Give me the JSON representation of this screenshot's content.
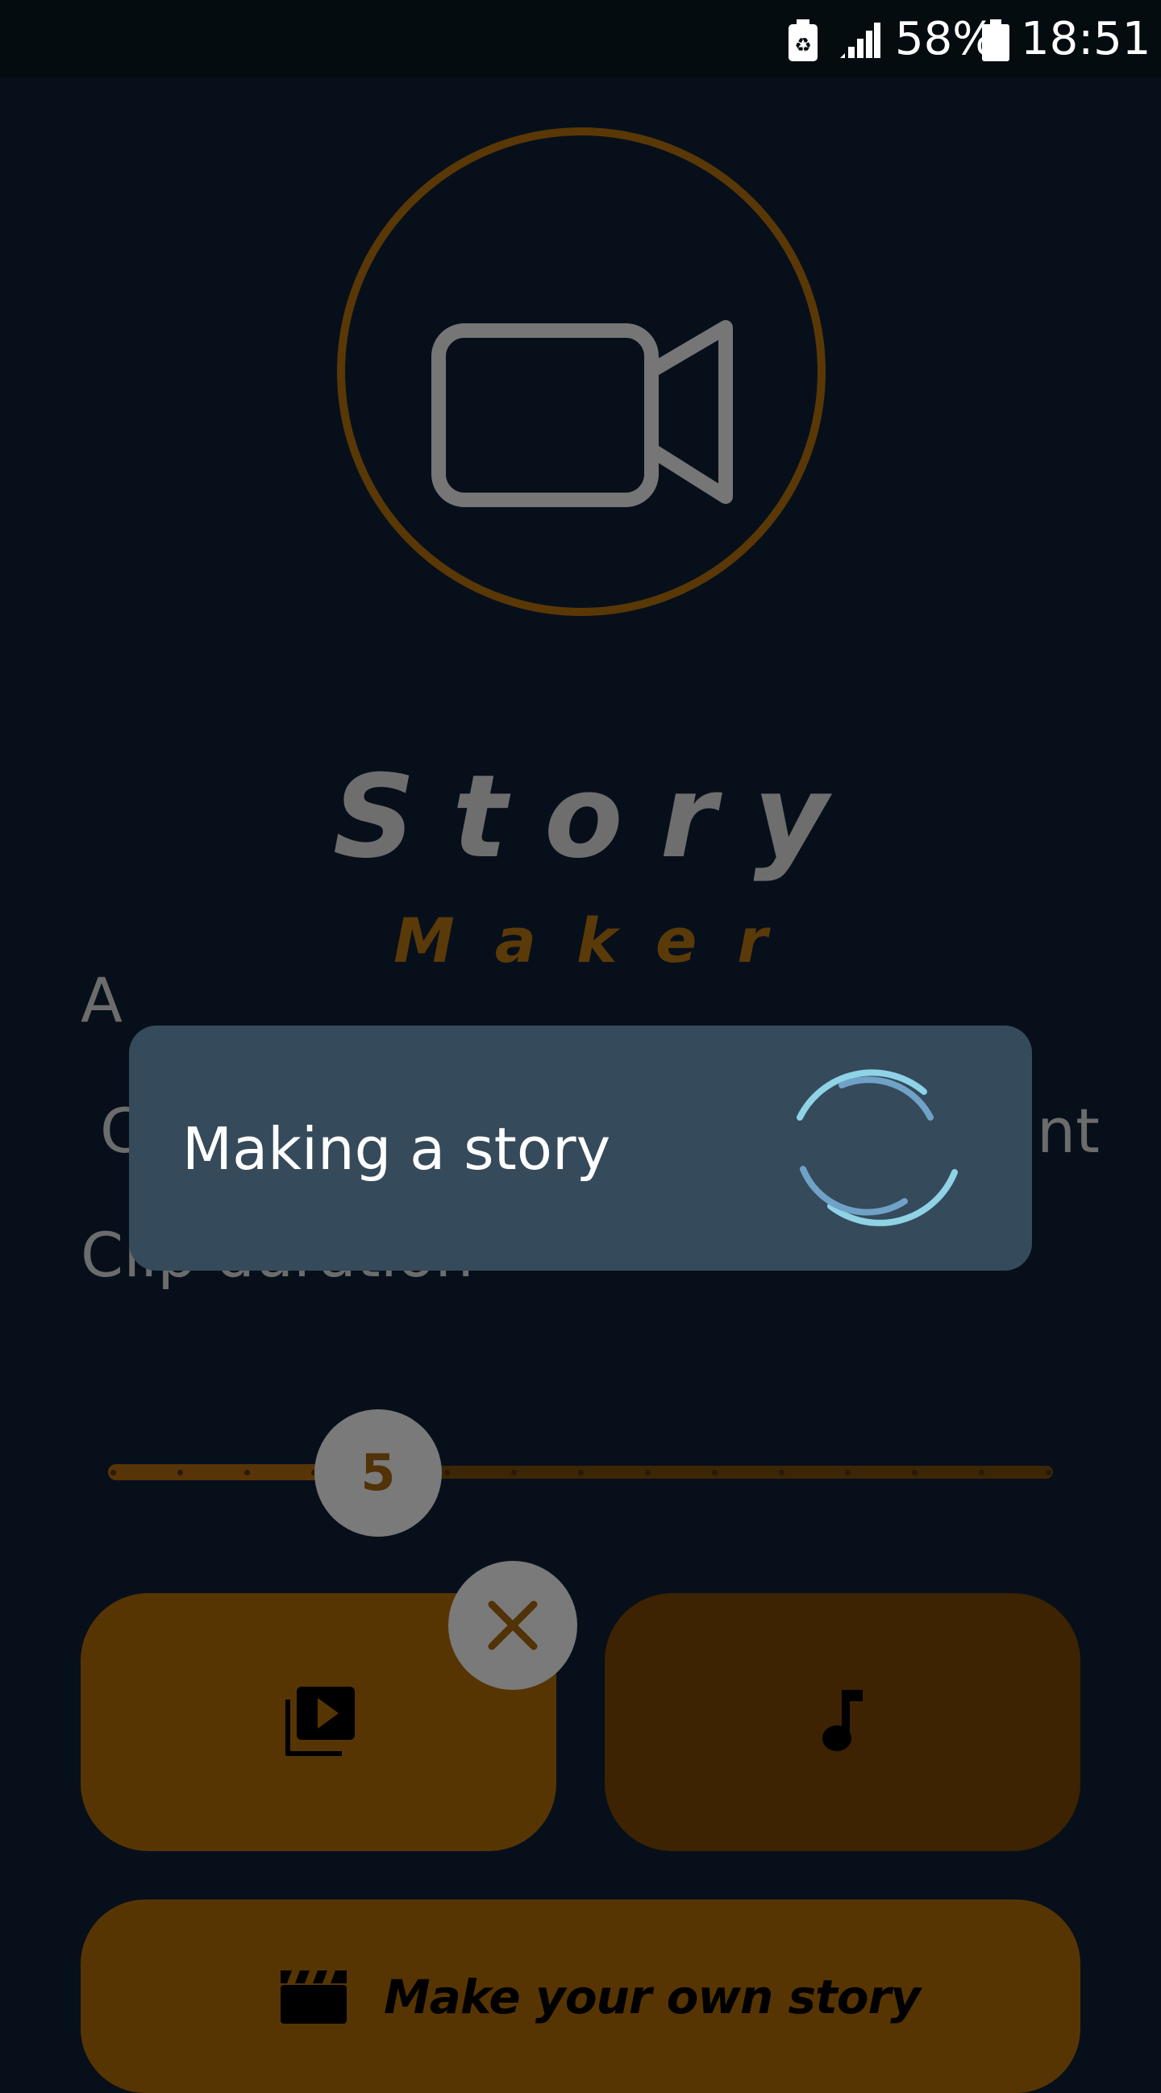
{
  "status_bar": {
    "battery_percent": "58%",
    "time": "18:51",
    "icons": [
      "battery-saver-icon",
      "signal-icon",
      "battery-icon"
    ]
  },
  "app": {
    "title_line1": "Story",
    "title_line2": "Maker",
    "background_label_top": "A",
    "background_label_radio_left": "C",
    "background_label_radio_right": "nt",
    "clip_duration_label": "Clip duration",
    "clip_duration": {
      "value": "5",
      "min": 1,
      "max": 15,
      "current": 5
    },
    "buttons": {
      "select_videos_icon": "video-library-icon",
      "select_music_icon": "music-note-icon",
      "clear_icon": "close-icon",
      "make_story_icon": "clapperboard-icon",
      "make_story_label": "Make your own story"
    },
    "logo_icon": "video-camera-icon"
  },
  "dialog": {
    "message": "Making a story",
    "spinner_icon": "loading-spinner-icon"
  },
  "colors": {
    "background": "#07101a",
    "accent_orange": "#573503",
    "accent_dark_orange": "#3d2302",
    "dialog_bg": "#354a5a",
    "spinner": "#8ed3e6"
  }
}
